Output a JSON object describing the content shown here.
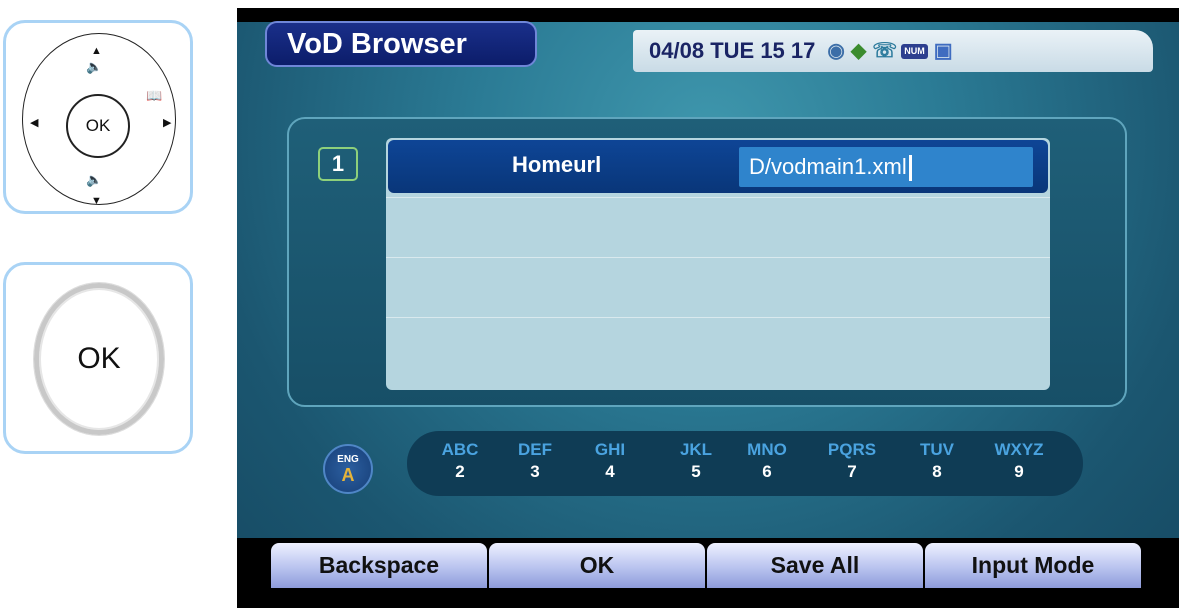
{
  "remote": {
    "dpad_ok": "OK",
    "ok_button": "OK"
  },
  "screen": {
    "title": "VoD Browser",
    "status": {
      "date": "04/08",
      "day": "TUE",
      "hour": "15",
      "minute": "17",
      "icons": [
        "globe-icon",
        "network-icon",
        "phone-icon",
        "num-icon",
        "pc-icon"
      ],
      "num_badge": "NUM"
    },
    "list": {
      "row_number": "1",
      "selected_label": "Homeurl",
      "selected_value": "D/vodmain1.xml"
    },
    "input_mode": {
      "lang": "ENG",
      "letter": "A"
    },
    "keypad": [
      {
        "letters": "ABC",
        "digit": "2"
      },
      {
        "letters": "DEF",
        "digit": "3"
      },
      {
        "letters": "GHI",
        "digit": "4"
      },
      {
        "letters": "JKL",
        "digit": "5"
      },
      {
        "letters": "MNO",
        "digit": "6"
      },
      {
        "letters": "PQRS",
        "digit": "7"
      },
      {
        "letters": "TUV",
        "digit": "8"
      },
      {
        "letters": "WXYZ",
        "digit": "9"
      }
    ],
    "softkeys": {
      "backspace": "Backspace",
      "ok": "OK",
      "save_all": "Save All",
      "input_mode": "Input Mode"
    }
  }
}
